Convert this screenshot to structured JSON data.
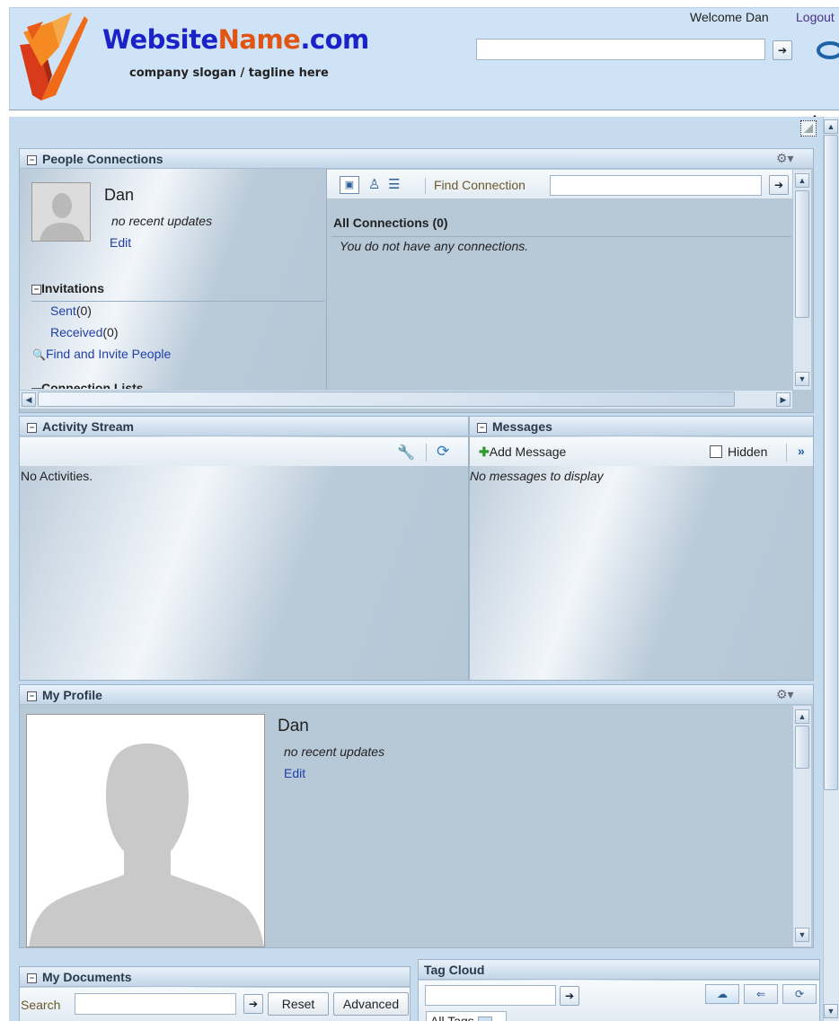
{
  "header": {
    "brand_part1": "Website",
    "brand_part2": "Name",
    "brand_part3": ".com",
    "slogan": "company slogan / tagline here",
    "welcome": "Welcome Dan",
    "logout": "Logout",
    "search_value": ""
  },
  "people": {
    "title": "People Connections",
    "name": "Dan",
    "status": "no recent updates",
    "edit": "Edit",
    "invitations_title": "Invitations",
    "sent_label": "Sent",
    "sent_count": "(0)",
    "received_label": "Received",
    "received_count": "(0)",
    "find_invite": "Find and Invite People",
    "lists_title": "Connection Lists",
    "find_connection": "Find Connection",
    "all_connections": "All Connections",
    "all_connections_count": "(0)",
    "no_connections": "You do not have any connections."
  },
  "activity": {
    "title": "Activity Stream",
    "empty": "No Activities."
  },
  "messages": {
    "title": "Messages",
    "add": "Add Message",
    "hidden": "Hidden",
    "more": "»",
    "empty": "No messages to display"
  },
  "profile": {
    "title": "My Profile",
    "name": "Dan",
    "status": "no recent updates",
    "edit": "Edit"
  },
  "documents": {
    "title": "My Documents",
    "search_label": "Search",
    "reset": "Reset",
    "advanced": "Advanced"
  },
  "tags": {
    "title": "Tag Cloud",
    "filter": "All Tags"
  }
}
